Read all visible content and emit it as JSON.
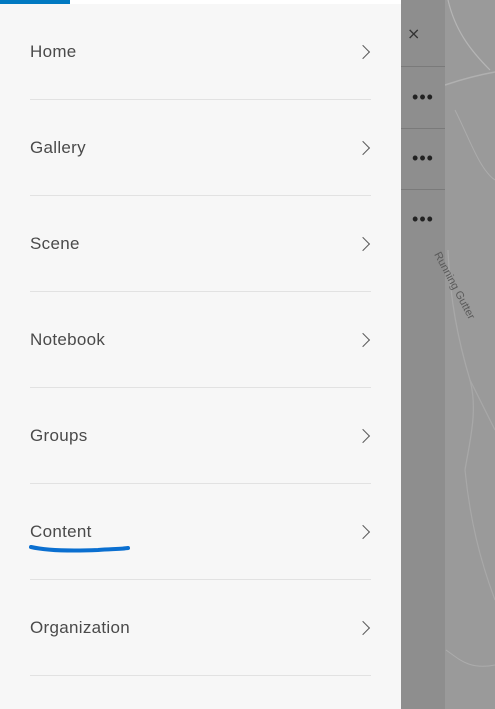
{
  "nav": {
    "items": [
      {
        "label": "Home"
      },
      {
        "label": "Gallery"
      },
      {
        "label": "Scene"
      },
      {
        "label": "Notebook"
      },
      {
        "label": "Groups"
      },
      {
        "label": "Content"
      },
      {
        "label": "Organization"
      }
    ]
  },
  "right_panel": {
    "close_symbol": "×",
    "menu_symbol": "•••"
  },
  "map": {
    "label": "Running Gutter"
  },
  "colors": {
    "accent": "#0079c1",
    "drawer_bg": "#f7f7f7",
    "annotation": "#0a6fd0"
  },
  "icons": {
    "nav_chevron": "chevron-right-icon",
    "close": "close-icon",
    "overflow": "ellipsis-icon"
  }
}
